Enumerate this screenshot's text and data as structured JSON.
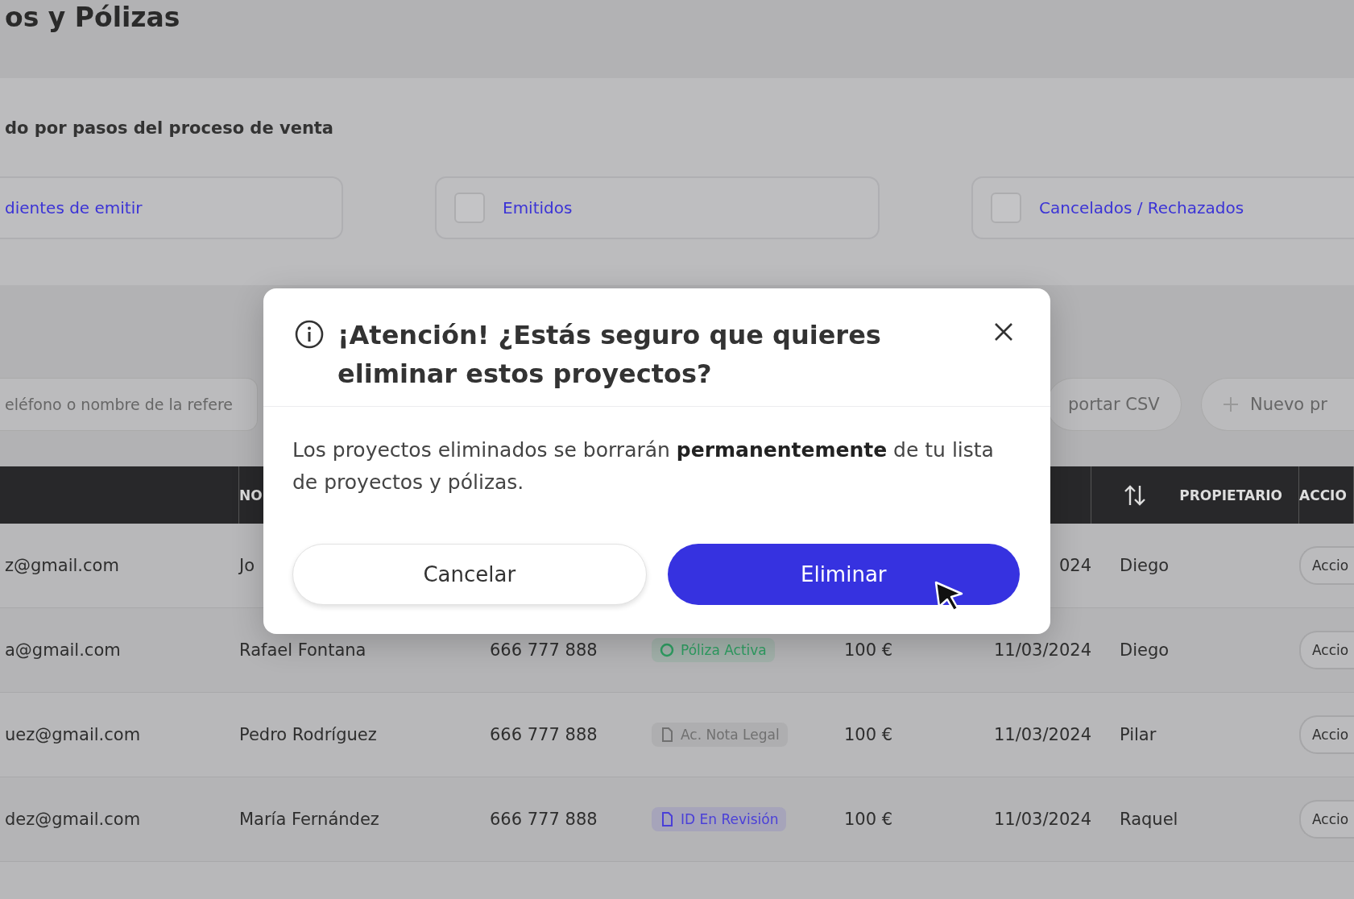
{
  "page": {
    "title": "os y Pólizas"
  },
  "pipeline": {
    "heading": "do por pasos del proceso de venta",
    "filters": [
      {
        "label": "dientes de emitir",
        "kind": "plain"
      },
      {
        "label": "Emitidos",
        "kind": "checkbox",
        "checked": false
      },
      {
        "label": "Cancelados / Rechazados",
        "kind": "checkbox",
        "checked": false
      }
    ]
  },
  "toolbar": {
    "search": {
      "placeholder": "eléfono o nombre de la refere"
    },
    "export_button": "portar CSV",
    "new_button": "Nuevo pr"
  },
  "table": {
    "columns": [
      "",
      "NO",
      "",
      "",
      "",
      "",
      "PROPIETARIO",
      "ACCIO"
    ],
    "rows": [
      {
        "cells": [
          "z@gmail.com",
          "Jo",
          "",
          null,
          "",
          "024",
          "Diego"
        ],
        "action": "Accio"
      },
      {
        "cells": [
          "a@gmail.com",
          "Rafael Fontana",
          "666 777 888",
          {
            "label": "Póliza Activa",
            "kind": "status",
            "color": "#2e9e62"
          },
          "100 €",
          "11/03/2024",
          "Diego"
        ],
        "action": "Accio"
      },
      {
        "cells": [
          "uez@gmail.com",
          "Pedro Rodríguez",
          "666 777 888",
          {
            "label": "Ac. Nota Legal",
            "kind": "document",
            "color": "#707070"
          },
          "100 €",
          "11/03/2024",
          "Pilar"
        ],
        "action": "Accio"
      },
      {
        "cells": [
          "dez@gmail.com",
          "María Fernández",
          "666 777 888",
          {
            "label": "ID En Revisión",
            "kind": "document",
            "color": "#4a3fd8"
          },
          "100 €",
          "11/03/2024",
          "Raquel"
        ],
        "action": "Accio"
      }
    ]
  },
  "dialog": {
    "title": "¡Atención! ¿Estás seguro que quieres eliminar estos proyectos?",
    "message": "Los proyectos eliminados se borrarán **permanentemente** de tu lista de proyectos y pólizas.",
    "buttons": [
      {
        "label": "Cancelar",
        "kind": "secondary"
      },
      {
        "label": "Eliminar",
        "kind": "primary"
      }
    ]
  }
}
